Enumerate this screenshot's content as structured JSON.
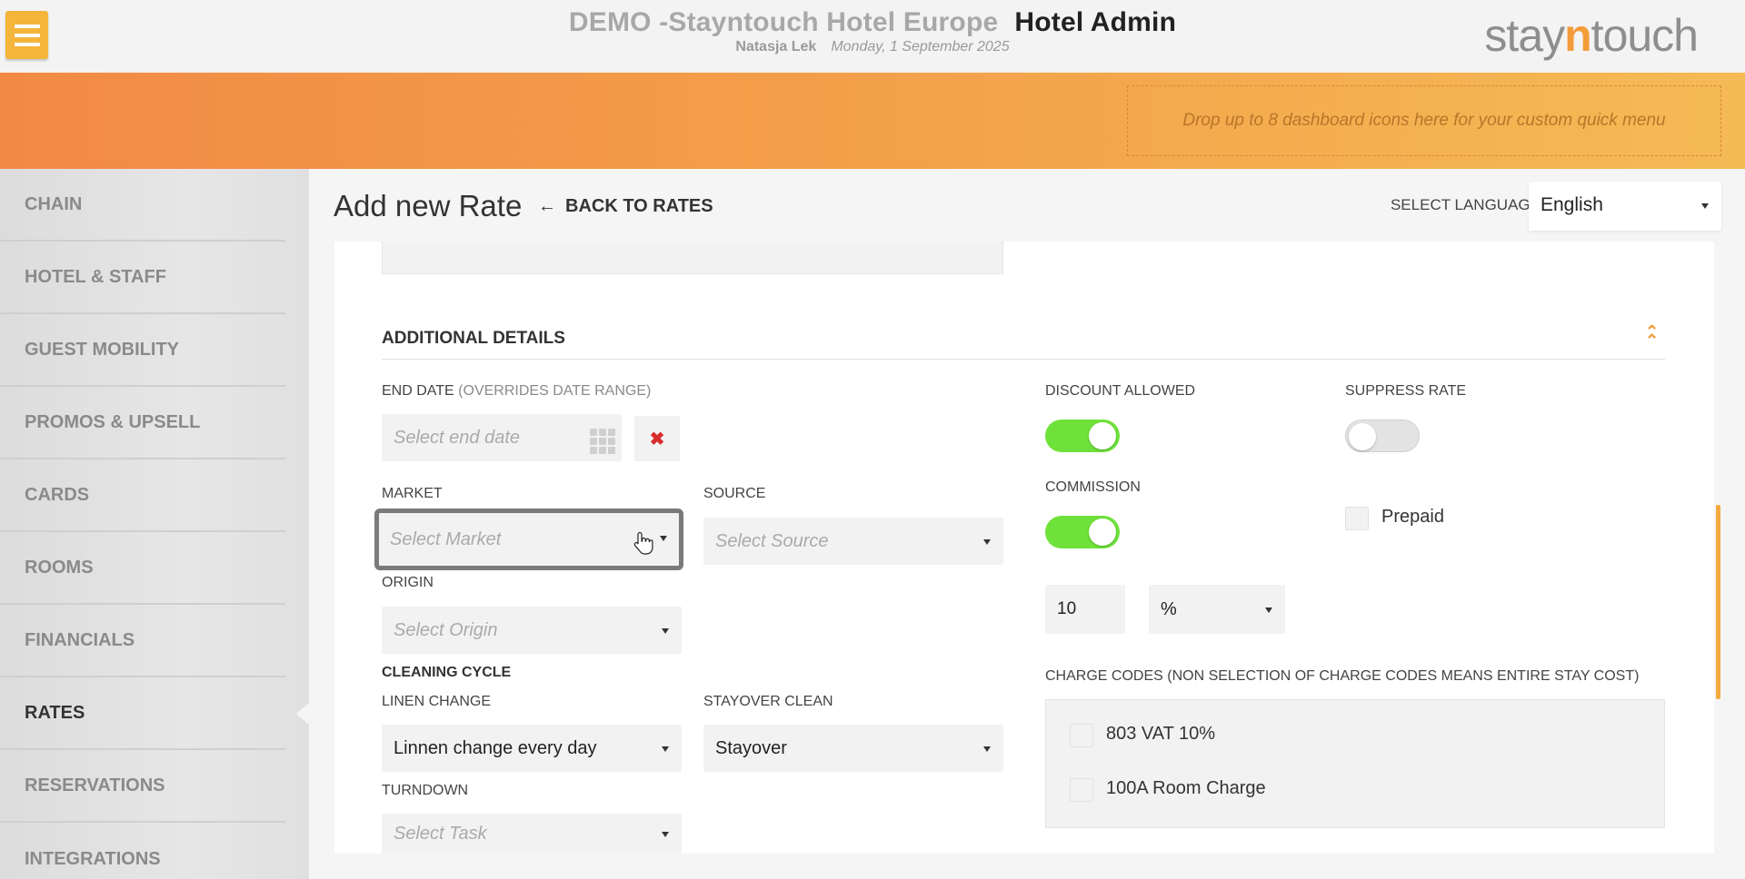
{
  "header": {
    "hotel_name": "DEMO -Stayntouch Hotel Europe",
    "app_name": "Hotel Admin",
    "user": "Natasja Lek",
    "date": "Monday, 1 September 2025",
    "logo_left": "stay",
    "logo_n": "n",
    "logo_right": "touch"
  },
  "quickmenu": {
    "placeholder": "Drop up to 8 dashboard icons here for your custom quick menu"
  },
  "sidebar": {
    "items": [
      {
        "label": "CHAIN"
      },
      {
        "label": "HOTEL & STAFF"
      },
      {
        "label": "GUEST MOBILITY"
      },
      {
        "label": "PROMOS & UPSELL"
      },
      {
        "label": "CARDS"
      },
      {
        "label": "ROOMS"
      },
      {
        "label": "FINANCIALS"
      },
      {
        "label": "RATES",
        "active": true
      },
      {
        "label": "RESERVATIONS"
      },
      {
        "label": "INTEGRATIONS"
      }
    ]
  },
  "page": {
    "title": "Add new Rate",
    "back_label": "BACK TO RATES",
    "language_label": "SELECT LANGUAGE",
    "language_value": "English"
  },
  "additional": {
    "section_title": "ADDITIONAL DETAILS",
    "end_date_label": "END DATE",
    "end_date_note": "(OVERRIDES DATE RANGE)",
    "end_date_placeholder": "Select end date",
    "market_label": "MARKET",
    "market_placeholder": "Select Market",
    "source_label": "SOURCE",
    "source_placeholder": "Select Source",
    "origin_label": "ORIGIN",
    "origin_placeholder": "Select Origin",
    "cleaning_title": "CLEANING CYCLE",
    "linen_label": "LINEN CHANGE",
    "linen_value": "Linnen change every day",
    "stayover_label": "STAYOVER CLEAN",
    "stayover_value": "Stayover",
    "turndown_label": "TURNDOWN",
    "turndown_placeholder": "Select Task",
    "discount_label": "DISCOUNT ALLOWED",
    "discount_on": true,
    "suppress_label": "SUPPRESS RATE",
    "suppress_on": false,
    "commission_label": "COMMISSION",
    "commission_on": true,
    "prepaid_label": "Prepaid",
    "commission_value": "10",
    "commission_unit": "%",
    "charge_codes_label": "CHARGE CODES (NON SELECTION OF CHARGE CODES MEANS ENTIRE STAY COST)",
    "charge_codes": [
      {
        "label": "803 VAT 10%"
      },
      {
        "label": "100A Room Charge"
      }
    ]
  },
  "colors": {
    "accent": "#f39c3a",
    "toggle_on": "#6ee23a",
    "clear": "#d72d2d"
  }
}
